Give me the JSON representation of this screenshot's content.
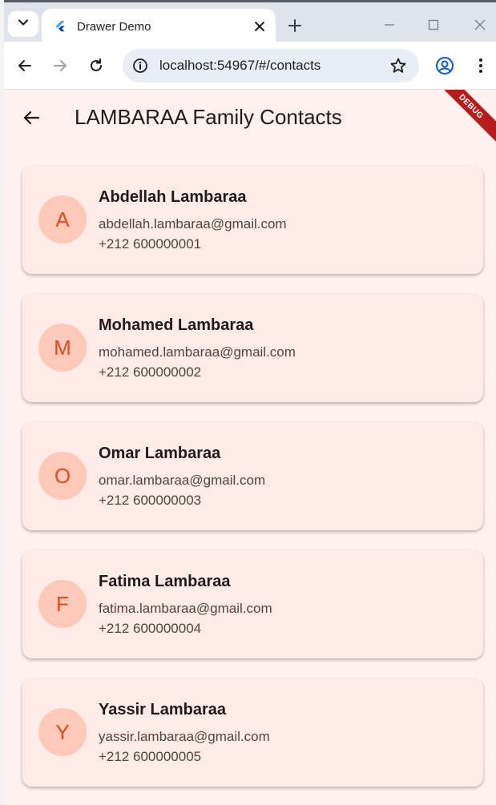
{
  "browser": {
    "tab_title": "Drawer Demo",
    "url": "localhost:54967/#/contacts"
  },
  "app": {
    "title": "LAMBARAA Family Contacts",
    "debug_banner": "DEBUG"
  },
  "contacts": [
    {
      "initial": "A",
      "name": "Abdellah Lambaraa",
      "email": "abdellah.lambaraa@gmail.com",
      "phone": "+212 600000001"
    },
    {
      "initial": "M",
      "name": "Mohamed Lambaraa",
      "email": "mohamed.lambaraa@gmail.com",
      "phone": "+212 600000002"
    },
    {
      "initial": "O",
      "name": "Omar Lambaraa",
      "email": "omar.lambaraa@gmail.com",
      "phone": "+212 600000003"
    },
    {
      "initial": "F",
      "name": "Fatima Lambaraa",
      "email": "fatima.lambaraa@gmail.com",
      "phone": "+212 600000004"
    },
    {
      "initial": "Y",
      "name": "Yassir Lambaraa",
      "email": "yassir.lambaraa@gmail.com",
      "phone": "+212 600000005"
    }
  ],
  "colors": {
    "accent": "#e8491d",
    "avatar_bg": "#ffc9b8",
    "card_bg": "#ffebe7",
    "page_bg": "#fff1ef"
  },
  "icons": {
    "tab_search": "chevron-down-icon",
    "favicon": "flutter-icon",
    "close": "close-icon",
    "new_tab": "plus-icon",
    "back": "arrow-left-icon",
    "forward": "arrow-right-icon",
    "reload": "reload-icon",
    "site_info": "info-icon",
    "bookmark": "star-icon",
    "profile": "profile-icon",
    "menu": "kebab-menu-icon"
  }
}
